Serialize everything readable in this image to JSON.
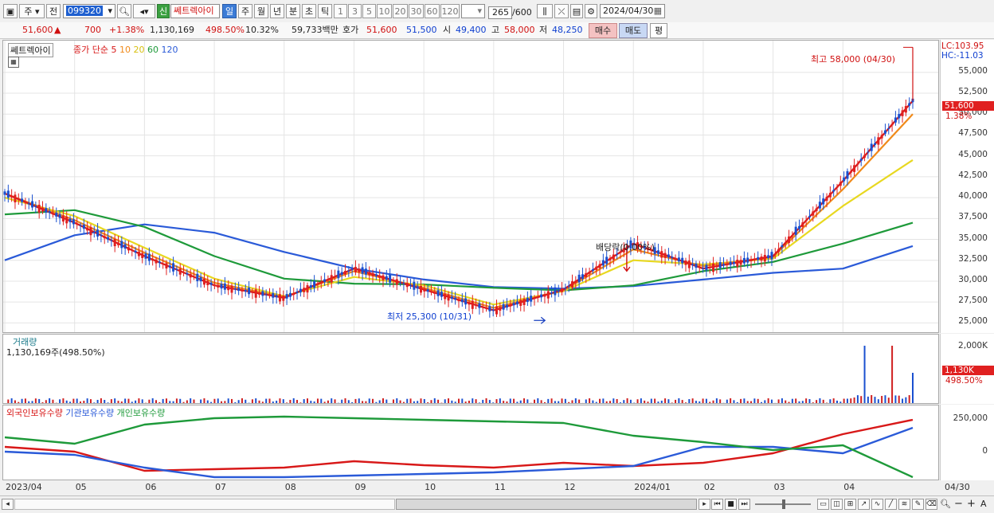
{
  "toolbar": {
    "chart_icon": "chart-layout-icon",
    "market_type": "주",
    "all_label": "전",
    "code": "099320",
    "new_badge": "신",
    "stock_name": "쎄트렉아이",
    "periods": [
      "일",
      "주",
      "월",
      "년",
      "분",
      "초",
      "틱"
    ],
    "selected_period": "일",
    "intervals": [
      "1",
      "3",
      "5",
      "10",
      "20",
      "30",
      "60",
      "120"
    ],
    "count_value": "265",
    "count_total": "/600",
    "date": "2024/04/30"
  },
  "quote": {
    "price": "51,600",
    "arrow": "▲",
    "change": "700",
    "change_pct": "+1.38%",
    "volume": "1,130,169",
    "volume_ratio": "498.50%",
    "turnover": "10.32%",
    "amount": "59,733백만",
    "hoga_label": "호가",
    "ask": "51,600",
    "bid": "51,500",
    "open_label": "시",
    "open": "49,400",
    "high_label": "고",
    "high": "58,000",
    "low_label": "저",
    "low": "48,250",
    "buy_label": "매수",
    "sell_label": "매도",
    "avg_label": "평"
  },
  "price_pane": {
    "title": "쎄트렉아이",
    "ma_label": "종가 단순",
    "ma_periods": [
      "5",
      "10",
      "20",
      "60",
      "120"
    ],
    "ma_colors": [
      "#d81818",
      "#f08a1a",
      "#e8d820",
      "#1e9a3a",
      "#2a5ad8"
    ],
    "lc": "LC:103.95",
    "hc": "HC:-11.03",
    "current_price": "51,600",
    "current_pct": "1.38%",
    "high_annotation": "최고 58,000 (04/30)",
    "low_annotation": "최저 25,300 (10/31)",
    "dividend_annotation": "배당락(0.00%)",
    "y_ticks": [
      "55,000",
      "52,500",
      "50,000",
      "47,500",
      "45,000",
      "42,500",
      "40,000",
      "37,500",
      "35,000",
      "32,500",
      "30,000",
      "27,500",
      "25,000"
    ]
  },
  "volume_pane": {
    "title": "거래량",
    "value": "1,130,169주(498.50%)",
    "current": "1,130K",
    "current_pct": "498.50%",
    "y_ticks": [
      "2,000K"
    ]
  },
  "holding_pane": {
    "series": [
      "외국인보유수량",
      "기관보유수량",
      "개인보유수량"
    ],
    "colors": [
      "#d81818",
      "#2a5ad8",
      "#1e9a3a"
    ],
    "y_ticks": [
      "250,000",
      "0"
    ]
  },
  "x_axis": {
    "labels": [
      "2023/04",
      "05",
      "06",
      "07",
      "08",
      "09",
      "10",
      "11",
      "12",
      "2024/01",
      "02",
      "03",
      "04"
    ],
    "last_date": "04/30"
  },
  "chart_data": {
    "type": "line",
    "title": "쎄트렉아이",
    "x": [
      "2023/04",
      "05",
      "06",
      "07",
      "08",
      "09",
      "10",
      "11",
      "12",
      "2024/01",
      "02",
      "03",
      "04",
      "04/30"
    ],
    "series": [
      {
        "name": "5",
        "values": [
          40500,
          37000,
          33000,
          29500,
          28000,
          31500,
          29000,
          26500,
          29000,
          34500,
          31500,
          33000,
          42000,
          51600
        ]
      },
      {
        "name": "10",
        "values": [
          40500,
          37300,
          33400,
          29800,
          28100,
          31200,
          29200,
          26800,
          28900,
          33800,
          31800,
          32900,
          41000,
          50000
        ]
      },
      {
        "name": "20",
        "values": [
          40000,
          37800,
          34000,
          30300,
          28200,
          30500,
          29500,
          27200,
          28800,
          32500,
          32000,
          32700,
          39000,
          44500
        ]
      },
      {
        "name": "60",
        "values": [
          38000,
          38500,
          36500,
          33000,
          30300,
          29700,
          29600,
          29200,
          28900,
          29500,
          31200,
          32300,
          34500,
          37000
        ]
      },
      {
        "name": "120",
        "values": [
          32500,
          35500,
          36800,
          35800,
          33500,
          31500,
          30200,
          29300,
          29100,
          29400,
          30200,
          31000,
          31500,
          34200
        ]
      }
    ],
    "ylim": [
      23700,
      58800
    ],
    "events": [
      {
        "label": "최고 58,000 (04/30)",
        "value": 58000
      },
      {
        "label": "최저 25,300 (10/31)",
        "value": 25300
      }
    ]
  }
}
